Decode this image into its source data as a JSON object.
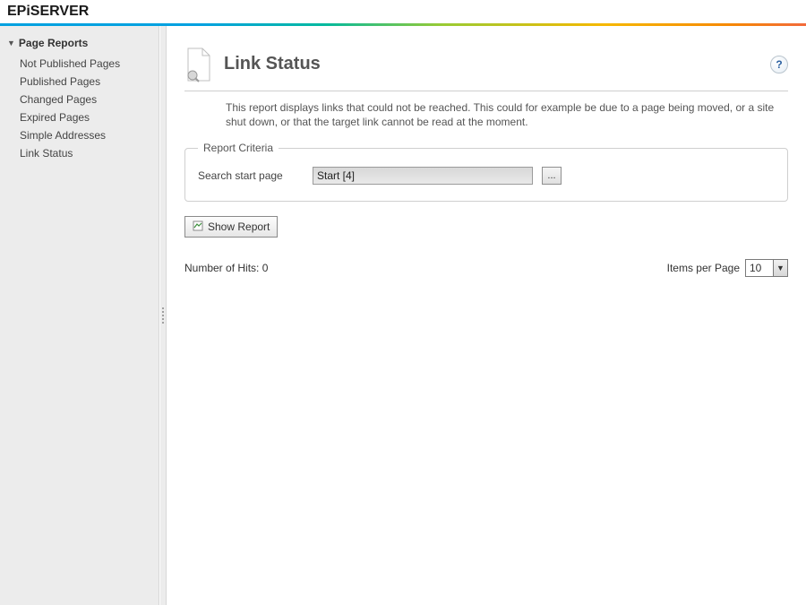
{
  "logo": "EPiSERVER",
  "sidebar": {
    "group_title": "Page Reports",
    "items": [
      "Not Published Pages",
      "Published Pages",
      "Changed Pages",
      "Expired Pages",
      "Simple Addresses",
      "Link Status"
    ]
  },
  "main": {
    "title": "Link Status",
    "description": "This report displays links that could not be reached. This could for example be due to a page being moved, or a site shut down, or that the target link cannot be read at the moment.",
    "criteria": {
      "legend": "Report Criteria",
      "start_page_label": "Search start page",
      "start_page_value": "Start [4]",
      "browse_label": "..."
    },
    "show_report_label": "Show Report",
    "hits_label": "Number of Hits: ",
    "hits_value": "0",
    "items_per_page_label": "Items per Page",
    "items_per_page_value": "10"
  }
}
